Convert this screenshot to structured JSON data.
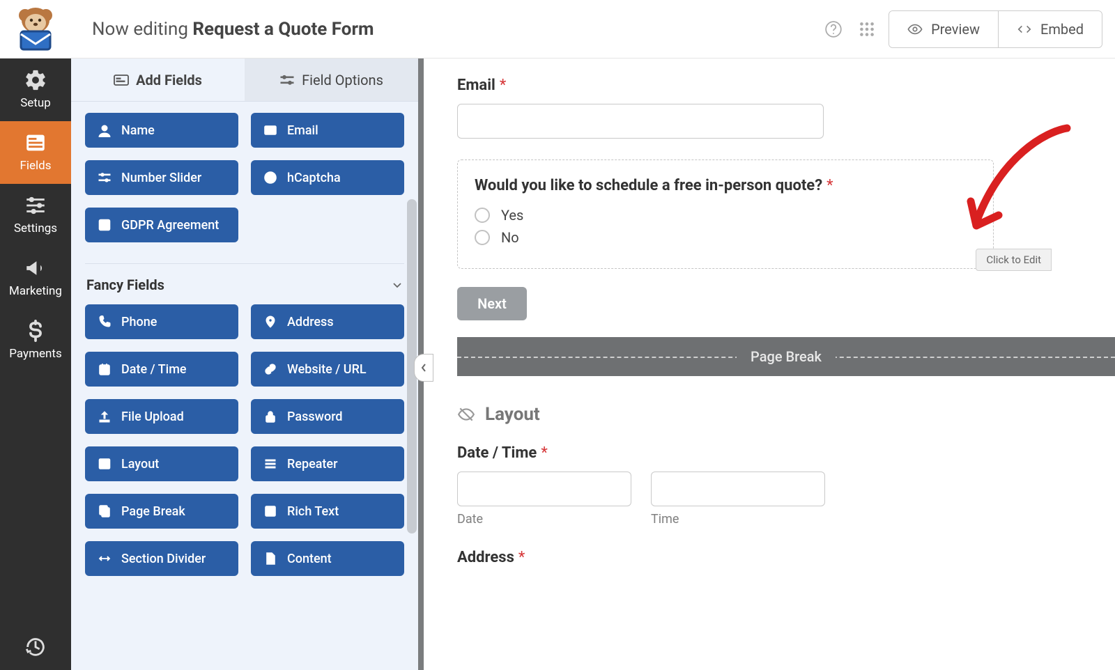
{
  "header": {
    "prefix": "Now editing",
    "title": "Request a Quote Form",
    "preview": "Preview",
    "embed": "Embed"
  },
  "leftnav": {
    "setup": "Setup",
    "fields": "Fields",
    "settings": "Settings",
    "marketing": "Marketing",
    "payments": "Payments"
  },
  "tabs": {
    "add": "Add Fields",
    "options": "Field Options"
  },
  "group1": {
    "name": "Name",
    "email": "Email",
    "slider": "Number Slider",
    "hcaptcha": "hCaptcha",
    "gdpr": "GDPR Agreement"
  },
  "fancy": {
    "title": "Fancy Fields",
    "phone": "Phone",
    "address": "Address",
    "datetime": "Date / Time",
    "url": "Website / URL",
    "fileupload": "File Upload",
    "password": "Password",
    "layout": "Layout",
    "repeater": "Repeater",
    "pagebreak": "Page Break",
    "richtext": "Rich Text",
    "sectiondivider": "Section Divider",
    "content": "Content"
  },
  "preview": {
    "email_label": "Email",
    "question": "Would you like to schedule a free in-person quote?",
    "yes": "Yes",
    "no": "No",
    "click_edit": "Click to Edit",
    "next": "Next",
    "pagebreak": "Page Break",
    "layout": "Layout",
    "datetime_label": "Date / Time",
    "date_sub": "Date",
    "time_sub": "Time",
    "address_label": "Address"
  }
}
